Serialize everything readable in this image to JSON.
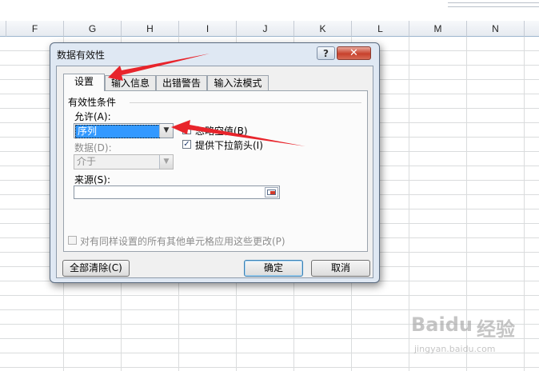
{
  "spreadsheet": {
    "columns": [
      "F",
      "G",
      "H",
      "I",
      "J",
      "K",
      "L",
      "M",
      "N"
    ]
  },
  "dialog": {
    "title": "数据有效性",
    "help_label": "?",
    "close_label": "✕",
    "tabs": [
      "设置",
      "输入信息",
      "出错警告",
      "输入法模式"
    ],
    "group_title": "有效性条件",
    "allow_label": "允许(A):",
    "allow_value": "序列",
    "ignore_blank_label": "忽略空值(B)",
    "ignore_blank_checked": true,
    "dropdown_label": "提供下拉箭头(I)",
    "dropdown_checked": true,
    "data_label": "数据(D):",
    "data_value": "介于",
    "source_label": "来源(S):",
    "source_value": "",
    "apply_all_label": "对有同样设置的所有其他单元格应用这些更改(P)",
    "apply_all_checked": false,
    "clear_all_button": "全部清除(C)",
    "ok_button": "确定",
    "cancel_button": "取消"
  },
  "annotations": {
    "arrow_color": "#e8242b"
  },
  "watermark": {
    "brand": "Baidu",
    "brand_cn": "经验",
    "url": "jingyan.baidu.com"
  },
  "icons": {
    "dropdown": "chevron-down-icon",
    "checkbox": "check-icon",
    "range_selector": "range-select-icon"
  }
}
